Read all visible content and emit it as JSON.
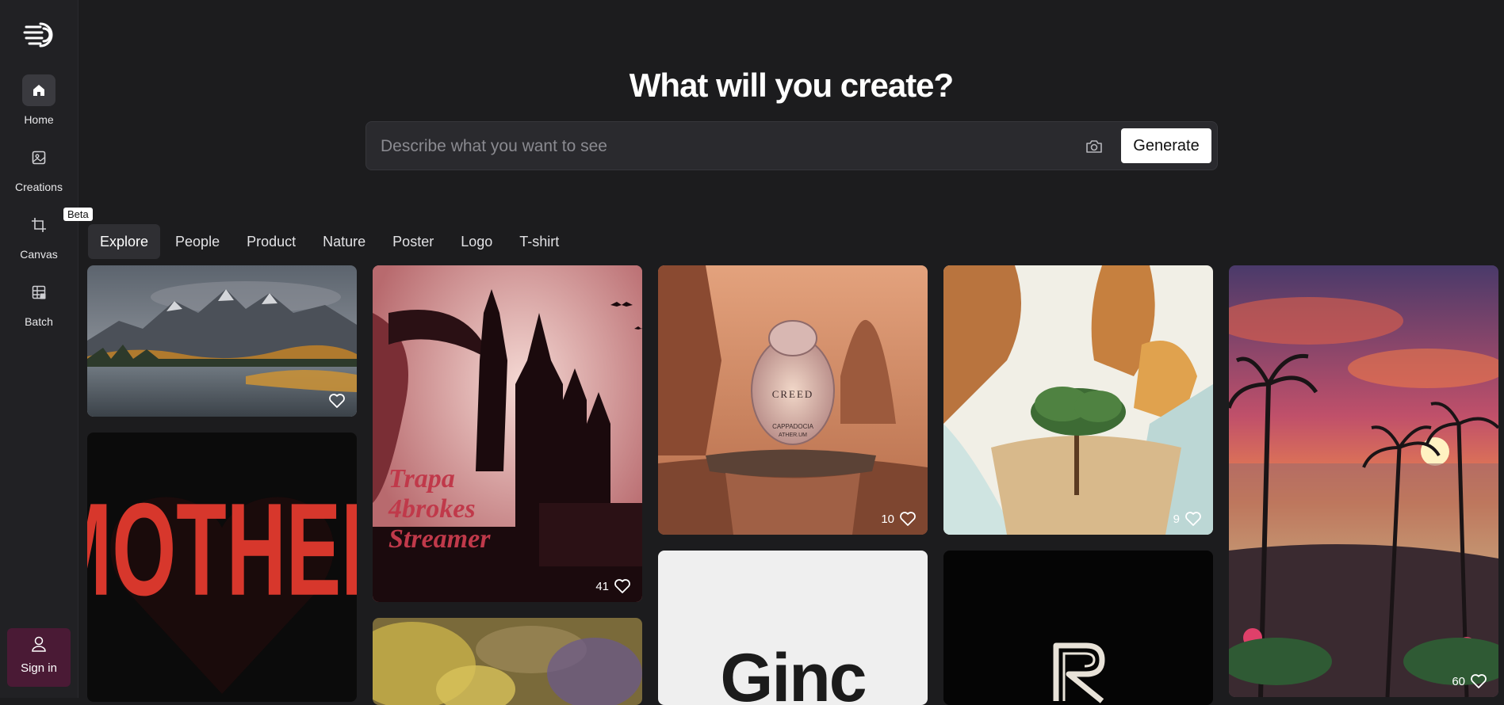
{
  "sidebar": {
    "items": [
      {
        "label": "Home",
        "icon": "home-icon"
      },
      {
        "label": "Creations",
        "icon": "image-icon"
      },
      {
        "label": "Canvas",
        "icon": "crop-icon",
        "badge": "Beta"
      },
      {
        "label": "Batch",
        "icon": "grid-icon"
      }
    ],
    "signin": "Sign in"
  },
  "hero": {
    "title": "What will you create?",
    "search_placeholder": "Describe what you want to see",
    "generate_label": "Generate"
  },
  "tabs": [
    "Explore",
    "People",
    "Product",
    "Nature",
    "Poster",
    "Logo",
    "T-shirt"
  ],
  "gallery": {
    "cards": [
      {
        "subject": "mountain lake",
        "likes": ""
      },
      {
        "subject": "MOTHER heart",
        "likes": ""
      },
      {
        "subject": "vampire castle poster",
        "likes": "41"
      },
      {
        "subject": "flowers",
        "likes": ""
      },
      {
        "subject": "perfume bottle",
        "likes": "10"
      },
      {
        "subject": "logo type",
        "likes": ""
      },
      {
        "subject": "desert tree",
        "likes": "9"
      },
      {
        "subject": "R logo",
        "likes": ""
      },
      {
        "subject": "sunset palms",
        "likes": "60"
      }
    ],
    "poster_text": [
      "Trapa",
      "4brokes",
      "Streamer"
    ],
    "mother_text": "MOTHER",
    "perfume_text": [
      "CREED",
      "CAPPADOCIA",
      "ATHER.UM"
    ],
    "logo_text": "Ginc"
  },
  "colors": {
    "accent": "#4a1a35",
    "bg": "#1c1c1e",
    "sidebar": "#212124"
  }
}
